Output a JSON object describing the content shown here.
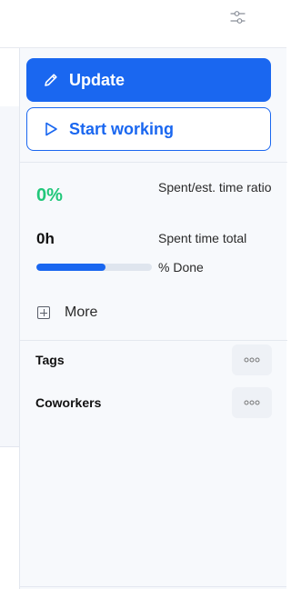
{
  "toolbar": {
    "filter_icon": "sliders-icon"
  },
  "actions": {
    "update_label": "Update",
    "update_icon": "pencil-icon",
    "start_label": "Start working",
    "start_icon": "play-icon"
  },
  "stats": {
    "ratio_value": "0%",
    "ratio_label": "Spent/est. time ratio",
    "spent_value": "0h",
    "spent_label": "Spent time total",
    "done_label": "% Done",
    "done_fraction": 0.6
  },
  "more": {
    "label": "More",
    "icon": "plus-square-icon"
  },
  "sections": {
    "tags_label": "Tags",
    "coworkers_label": "Coworkers",
    "menu_icon": "more-dots-icon"
  },
  "colors": {
    "primary": "#1a67f0",
    "success": "#21c77a",
    "panel_bg": "#f7f9fc"
  }
}
